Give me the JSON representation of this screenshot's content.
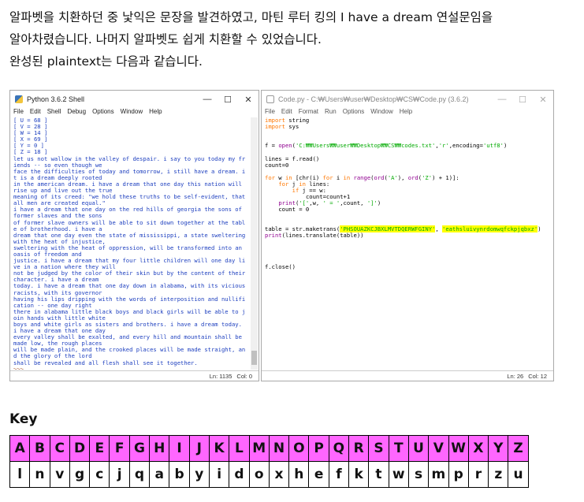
{
  "intro": {
    "line1": "알파벳을 치환하던 중 낯익은 문장을 발견하였고, 마틴 루터 킹의 I have a dream 연설문임을",
    "line2": "알아차렸습니다. 나머지 알파벳도 쉽게 치환할 수 있었습니다.",
    "line3": "완성된 plaintext는 다음과 같습니다."
  },
  "shell": {
    "title": "Python 3.6.2 Shell",
    "menu": [
      "File",
      "Edit",
      "Shell",
      "Debug",
      "Options",
      "Window",
      "Help"
    ],
    "lines": [
      "[ U  =  68 ]",
      "[ V  =  28 ]",
      "[ W  =  14 ]",
      "[ X  =  69 ]",
      "[ Y  =  0 ]",
      "[ Z  =  18 ]",
      "let us not wallow in the valley of despair. i say to you today my fr",
      "iends -- so even though we",
      "face the difficulties of today and tomorrow, i still have a dream. i",
      "t is a dream deeply rooted",
      "in the american dream. i have a dream that one day this nation will",
      "rise up and live out the true",
      "meaning of its creed: \"we hold these truths to be self-evident, that",
      "all men are created equal.\"",
      "i have a dream that one day on the red hills of georgia the sons of",
      "former slaves and the sons",
      "of former slave owners will be able to sit down together at the tabl",
      "e of brotherhood. i have a",
      "dream that one day even the state of mississippi, a state sweltering",
      "with the heat of injustice,",
      "sweltering with the heat of oppression, will be transformed into an",
      "oasis of freedom and",
      "justice. i have a dream that my four little children will one day li",
      "ve in a nation where they will",
      "not be judged by the color of their skin but by the content of their",
      "character. i have a dream",
      "today. i have a dream that one day down in alabama, with its vicious",
      "racists, with its governor",
      "having his lips dripping with the words of interposition and nullifi",
      "cation -- one day right",
      "there in alabama little black boys and black girls will be able to j",
      "oin hands with little white",
      "boys and white girls as sisters and brothers. i have a dream today.",
      "i have a dream that one day",
      "every valley shall be exalted, and every hill and mountain shall be",
      "made low, the rough places",
      "will be made plain, and the crooked places will be made straight, an",
      "d the glory of the lord",
      "shall be revealed and all flesh shall see it together."
    ],
    "prompt": ">>>",
    "status_ln": "Ln: 1135",
    "status_col": "Col: 0"
  },
  "editor": {
    "title": "Code.py - C:₩Users₩user₩Desktop₩CS₩Code.py (3.6.2)",
    "menu": [
      "File",
      "Edit",
      "Format",
      "Run",
      "Options",
      "Window",
      "Help"
    ],
    "code": {
      "l1_kw": "import",
      "l1_rest": " string",
      "l2_kw": "import",
      "l2_rest": " sys",
      "l3_a": "f = ",
      "l3_bi": "open",
      "l3_b": "(",
      "l3_s1": "'C:₩₩Users₩₩user₩₩Desktop₩₩CS₩₩codes.txt'",
      "l3_c": ",",
      "l3_s2": "'r'",
      "l3_d": ",encoding=",
      "l3_s3": "'utf8'",
      "l3_e": ")",
      "l4": "lines = f.read()",
      "l5": "count=0",
      "l6_kw1": "for",
      "l6_a": " w ",
      "l6_kw2": "in",
      "l6_b": " [chr(i) ",
      "l6_kw3": "for",
      "l6_c": " i ",
      "l6_kw4": "in",
      "l6_d": " ",
      "l6_bi": "range",
      "l6_e": "(",
      "l6_bi2": "ord",
      "l6_f": "(",
      "l6_s1": "'A'",
      "l6_g": "), ",
      "l6_bi3": "ord",
      "l6_h": "(",
      "l6_s2": "'Z'",
      "l6_i": ") + 1)]:",
      "l7_kw1": "for",
      "l7_a": " j ",
      "l7_kw2": "in",
      "l7_b": " lines:",
      "l8_kw": "if",
      "l8_a": " j == w:",
      "l9": "count=count+1",
      "l10_bi": "print",
      "l10_a": "(",
      "l10_s1": "'['",
      "l10_b": ",w, ",
      "l10_s2": "' = '",
      "l10_c": ",count, ",
      "l10_s3": "']'",
      "l10_d": ")",
      "l11": "count = 0",
      "l12_a": "table = str.maketrans(",
      "l12_s1": "'PHSOUAZKCJBXLMVTDQERWFGINY'",
      "l12_b": ", ",
      "l12_s2": "'eathsluivynrdomwqfckpjqbxz'",
      "l12_c": ")",
      "l13_bi": "print",
      "l13_a": "(lines.translate(table))",
      "l14": "f.close()"
    },
    "status_ln": "Ln: 26",
    "status_col": "Col: 12"
  },
  "key": {
    "heading": "Key",
    "plain": [
      "A",
      "B",
      "C",
      "D",
      "E",
      "F",
      "G",
      "H",
      "I",
      "J",
      "K",
      "L",
      "M",
      "N",
      "O",
      "P",
      "Q",
      "R",
      "S",
      "T",
      "U",
      "V",
      "W",
      "X",
      "Y",
      "Z"
    ],
    "cipher": [
      "l",
      "n",
      "v",
      "g",
      "c",
      "j",
      "q",
      "a",
      "b",
      "y",
      "i",
      "d",
      "o",
      "x",
      "h",
      "e",
      "f",
      "k",
      "t",
      "w",
      "s",
      "m",
      "p",
      "r",
      "z",
      "u"
    ]
  },
  "colors": {
    "key_header_bg": "#ff66ff",
    "highlight": "#ffff00",
    "shell_text": "#1d3fbf",
    "keyword": "#ff7700",
    "string": "#00aa00",
    "builtin": "#900090"
  }
}
